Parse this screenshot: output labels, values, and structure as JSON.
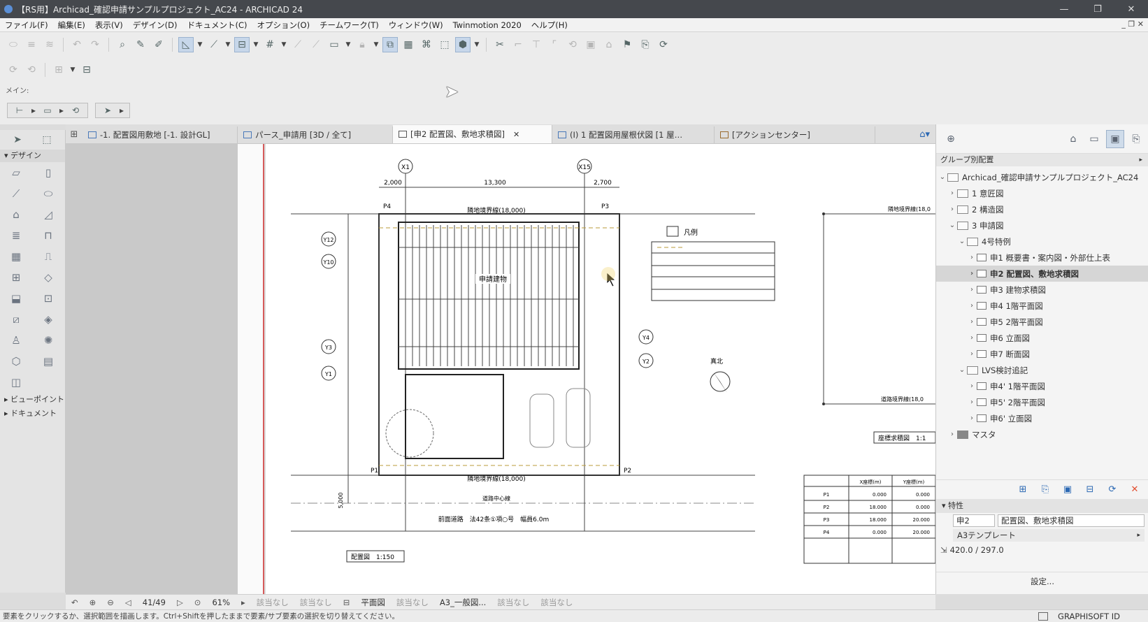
{
  "window": {
    "title": "【RS用】Archicad_確認申請サンプルプロジェクト_AC24 - ARCHICAD 24",
    "controls": [
      "—",
      "❐",
      "✕"
    ]
  },
  "menu": {
    "items": [
      "ファイル(F)",
      "編集(E)",
      "表示(V)",
      "デザイン(D)",
      "ドキュメント(C)",
      "オプション(O)",
      "チームワーク(T)",
      "ウィンドウ(W)",
      "Twinmotion 2020",
      "ヘルプ(H)"
    ],
    "mdi_controls": "_ ❐ ✕"
  },
  "info_box": {
    "main_label": "メイン:"
  },
  "toolbox": {
    "design_header": "デザイン",
    "sections": [
      "ビューポイント",
      "ドキュメント"
    ]
  },
  "tabs": [
    {
      "label": "-1. 配置図用敷地 [-1. 設計GL]"
    },
    {
      "label": "パース_申請用 [3D / 全て]"
    },
    {
      "label": "[申2 配置図、敷地求積図]",
      "active": true
    },
    {
      "label": "(I) 1 配置図用屋根伏図 [1 屋…"
    },
    {
      "label": "[アクションセンター]"
    }
  ],
  "canvas_status": {
    "page": "41/49",
    "zoom": "61%",
    "none1": "該当なし",
    "none2": "該当なし",
    "view": "平面図",
    "none3": "該当なし",
    "layer": "A3_一般図...",
    "none4": "該当なし",
    "none5": "該当なし"
  },
  "drawing": {
    "grid_x1": "X1",
    "grid_x15": "X15",
    "grid_y12": "Y12",
    "grid_y10": "Y10",
    "grid_y3": "Y3",
    "grid_y1": "Y1",
    "grid_y4": "Y4",
    "grid_y2": "Y2",
    "dim_2000": "2,000",
    "dim_13300": "13,300",
    "dim_2700": "2,700",
    "dim_5000": "5,000",
    "road_top": "隣地境界線(18,000)",
    "road_bottom": "隣地境界線(18,000)",
    "road_name": "前面道路　法42条①項○号　幅員6.0m",
    "road_center": "道路中心線",
    "legend_title": "凡例",
    "north_label": "真北",
    "p1": "P1",
    "p2": "P2",
    "p3": "P3",
    "p4": "P4",
    "building_label": "申請建物",
    "scale_label": "配置図　1:150",
    "area_label": "座標求積図　1:1",
    "right_top_label": "隣地境界線(18,0",
    "right_bottom_label": "道路境界線(18,0",
    "coord_table": {
      "headers": [
        "",
        "X座標(m)",
        "Y座標(m)"
      ],
      "rows": [
        [
          "P1",
          "0.000",
          "0.000"
        ],
        [
          "P2",
          "18.000",
          "0.000"
        ],
        [
          "P3",
          "18.000",
          "20.000"
        ],
        [
          "P4",
          "0.000",
          "20.000"
        ]
      ]
    }
  },
  "navigator": {
    "view_selector": "グループ別配置",
    "tree": [
      {
        "label": "Archicad_確認申請サンプルプロジェクト_AC24",
        "level": 0,
        "toggle": "⌄",
        "kind": "book"
      },
      {
        "label": "1 意匠図",
        "level": 1,
        "toggle": "›",
        "kind": "folder"
      },
      {
        "label": "2 構造図",
        "level": 1,
        "toggle": "›",
        "kind": "folder"
      },
      {
        "label": "3 申請図",
        "level": 1,
        "toggle": "⌄",
        "kind": "folder"
      },
      {
        "label": "4号特例",
        "level": 2,
        "toggle": "⌄",
        "kind": "folder"
      },
      {
        "label": "申1 概要書・案内図・外部仕上表",
        "level": 3,
        "toggle": "›",
        "kind": "layout"
      },
      {
        "label": "申2 配置図、敷地求積図",
        "level": 3,
        "toggle": "›",
        "kind": "layout",
        "selected": true
      },
      {
        "label": "申3 建物求積図",
        "level": 3,
        "toggle": "›",
        "kind": "layout"
      },
      {
        "label": "申4 1階平面図",
        "level": 3,
        "toggle": "›",
        "kind": "layout"
      },
      {
        "label": "申5 2階平面図",
        "level": 3,
        "toggle": "›",
        "kind": "layout"
      },
      {
        "label": "申6 立面図",
        "level": 3,
        "toggle": "›",
        "kind": "layout"
      },
      {
        "label": "申7 断面図",
        "level": 3,
        "toggle": "›",
        "kind": "layout"
      },
      {
        "label": "LVS検討追記",
        "level": 2,
        "toggle": "⌄",
        "kind": "folder"
      },
      {
        "label": "申4' 1階平面図",
        "level": 3,
        "toggle": "›",
        "kind": "layout"
      },
      {
        "label": "申5' 2階平面図",
        "level": 3,
        "toggle": "›",
        "kind": "layout"
      },
      {
        "label": "申6' 立面図",
        "level": 3,
        "toggle": "›",
        "kind": "layout"
      },
      {
        "label": "マスタ",
        "level": 1,
        "toggle": "›",
        "kind": "master"
      }
    ],
    "properties": {
      "header": "特性",
      "id": "申2",
      "name": "配置図、敷地求積図",
      "template": "A3テンプレート",
      "size": "420.0 / 297.0",
      "settings": "設定..."
    }
  },
  "statusbar": {
    "message": "要素をクリックするか、選択範囲を描画します。Ctrl+Shiftを押したままで要素/サブ要素の選択を切り替えてください。",
    "graphisoft_id": "GRAPHISOFT ID"
  }
}
